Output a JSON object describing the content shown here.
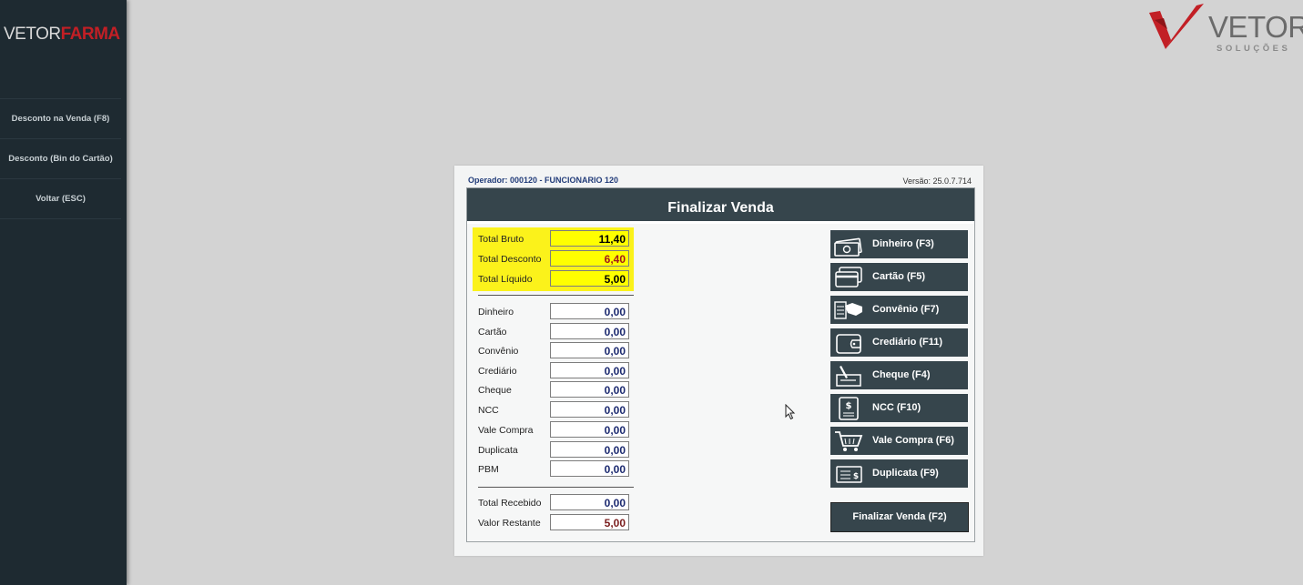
{
  "sidebar": {
    "logo_part1": "VETOR",
    "logo_part2": "FARMA",
    "items": [
      {
        "label": "Desconto na Venda (F8)"
      },
      {
        "label": "Desconto (Bin do Cartão)"
      },
      {
        "label": "Voltar (ESC)"
      }
    ]
  },
  "brand": {
    "name": "VETOR",
    "subtitle": "SOLUÇÕES"
  },
  "dialog": {
    "operator": "Operador: 000120 - FUNCIONARIO 120",
    "version": "Versão: 25.0.7.714",
    "title": "Finalizar Venda",
    "totals": [
      {
        "label": "Total Bruto",
        "value": "11,40"
      },
      {
        "label": "Total Desconto",
        "value": "6,40"
      },
      {
        "label": "Total Líquido",
        "value": "5,00"
      }
    ],
    "payments": [
      {
        "label": "Dinheiro",
        "value": "0,00"
      },
      {
        "label": "Cartão",
        "value": "0,00"
      },
      {
        "label": "Convênio",
        "value": "0,00"
      },
      {
        "label": "Crediário",
        "value": "0,00"
      },
      {
        "label": "Cheque",
        "value": "0,00"
      },
      {
        "label": "NCC",
        "value": "0,00"
      },
      {
        "label": "Vale Compra",
        "value": "0,00"
      },
      {
        "label": "Duplicata",
        "value": "0,00"
      },
      {
        "label": "PBM",
        "value": "0,00"
      }
    ],
    "summary": [
      {
        "label": "Total Recebido",
        "value": "0,00"
      },
      {
        "label": "Valor Restante",
        "value": "5,00"
      }
    ],
    "buttons": [
      {
        "label": "Dinheiro (F3)",
        "icon": "money-icon"
      },
      {
        "label": "Cartão (F5)",
        "icon": "credit-card-icon"
      },
      {
        "label": "Convênio (F7)",
        "icon": "handshake-icon"
      },
      {
        "label": "Crediário (F11)",
        "icon": "wallet-icon"
      },
      {
        "label": "Cheque (F4)",
        "icon": "check-pen-icon"
      },
      {
        "label": "NCC (F10)",
        "icon": "dollar-document-icon"
      },
      {
        "label": "Vale Compra (F6)",
        "icon": "shopping-cart-icon"
      },
      {
        "label": "Duplicata (F9)",
        "icon": "bill-icon"
      }
    ],
    "finalize_label": "Finalizar Venda (F2)"
  },
  "colors": {
    "sidebar": "#1e2a31",
    "button": "#36454c",
    "highlight": "#fbf21b",
    "brand_red": "#c21f25"
  }
}
